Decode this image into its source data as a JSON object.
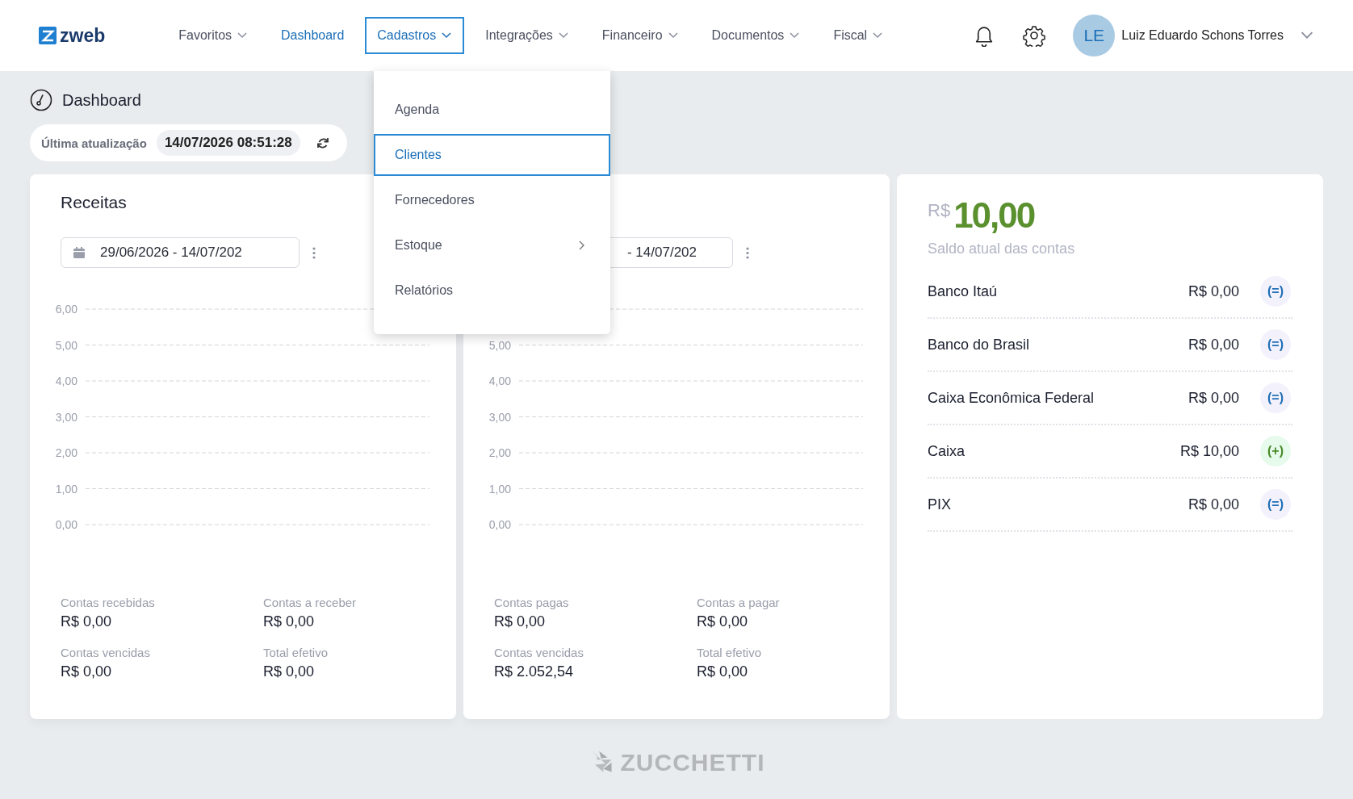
{
  "header": {
    "logo": "zweb",
    "nav": [
      {
        "label": "Favoritos",
        "dropdown": true,
        "current": false,
        "selected": false
      },
      {
        "label": "Dashboard",
        "dropdown": false,
        "current": true,
        "selected": false
      },
      {
        "label": "Cadastros",
        "dropdown": true,
        "current": false,
        "selected": true
      },
      {
        "label": "Integrações",
        "dropdown": true,
        "current": false,
        "selected": false
      },
      {
        "label": "Financeiro",
        "dropdown": true,
        "current": false,
        "selected": false
      },
      {
        "label": "Documentos",
        "dropdown": true,
        "current": false,
        "selected": false
      },
      {
        "label": "Fiscal",
        "dropdown": true,
        "current": false,
        "selected": false
      }
    ],
    "user": {
      "initials": "LE",
      "name": "Luiz Eduardo Schons Torres"
    }
  },
  "page_title": "Dashboard",
  "last_update": {
    "label": "Última atualização",
    "value": "14/07/2026 08:51:28"
  },
  "cadastros_menu": [
    {
      "label": "Agenda",
      "kind": "item",
      "selected": false
    },
    {
      "label": "Clientes",
      "kind": "item",
      "selected": true
    },
    {
      "label": "Fornecedores",
      "kind": "item",
      "selected": false
    },
    {
      "label": "Estoque",
      "kind": "submenu",
      "selected": false
    },
    {
      "label": "Relatórios",
      "kind": "item",
      "selected": false
    }
  ],
  "cards": [
    {
      "title": "Receitas",
      "date_range": "29/06/2026 - 14/07/202",
      "calendar": true,
      "empty_chart": {
        "axis_labels": [
          "6,00",
          "5,00",
          "4,00",
          "3,00",
          "2,00",
          "1,00",
          "0,00"
        ]
      },
      "stats": [
        {
          "label": "Contas recebidas",
          "value": "R$ 0,00"
        },
        {
          "label": "Contas a receber",
          "value": "R$ 0,00"
        },
        {
          "label": "Contas vencidas",
          "value": "R$ 0,00"
        },
        {
          "label": "Total efetivo",
          "value": "R$ 0,00"
        }
      ]
    },
    {
      "date_range": "- 14/07/202",
      "calendar": false,
      "empty_chart": {
        "axis_labels": [
          "5,00",
          "4,00",
          "3,00",
          "2,00",
          "1,00",
          "0,00"
        ]
      },
      "stats": [
        {
          "label": "Contas pagas",
          "value": "R$ 0,00"
        },
        {
          "label": "Contas a pagar",
          "value": "R$ 0,00"
        },
        {
          "label": "Contas vencidas",
          "value": "R$ 2.052,54"
        },
        {
          "label": "Total efetivo",
          "value": "R$ 0,00"
        }
      ]
    }
  ],
  "balance": {
    "currency": "R$",
    "total": "10,00",
    "caption": "Saldo atual das contas",
    "accounts": [
      {
        "name": "Banco Itaú",
        "amount": "R$ 0,00",
        "kind": "equal",
        "symbol": "(=)"
      },
      {
        "name": "Banco do Brasil",
        "amount": "R$ 0,00",
        "kind": "equal",
        "symbol": "(=)"
      },
      {
        "name": "Caixa Econômica Federal",
        "amount": "R$ 0,00",
        "kind": "equal",
        "symbol": "(=)"
      },
      {
        "name": "Caixa",
        "amount": "R$ 10,00",
        "kind": "plus",
        "symbol": "(+)"
      },
      {
        "name": "PIX",
        "amount": "R$ 0,00",
        "kind": "equal",
        "symbol": "(=)"
      }
    ]
  },
  "footer": {
    "brand": "ZUCCHETTI"
  }
}
